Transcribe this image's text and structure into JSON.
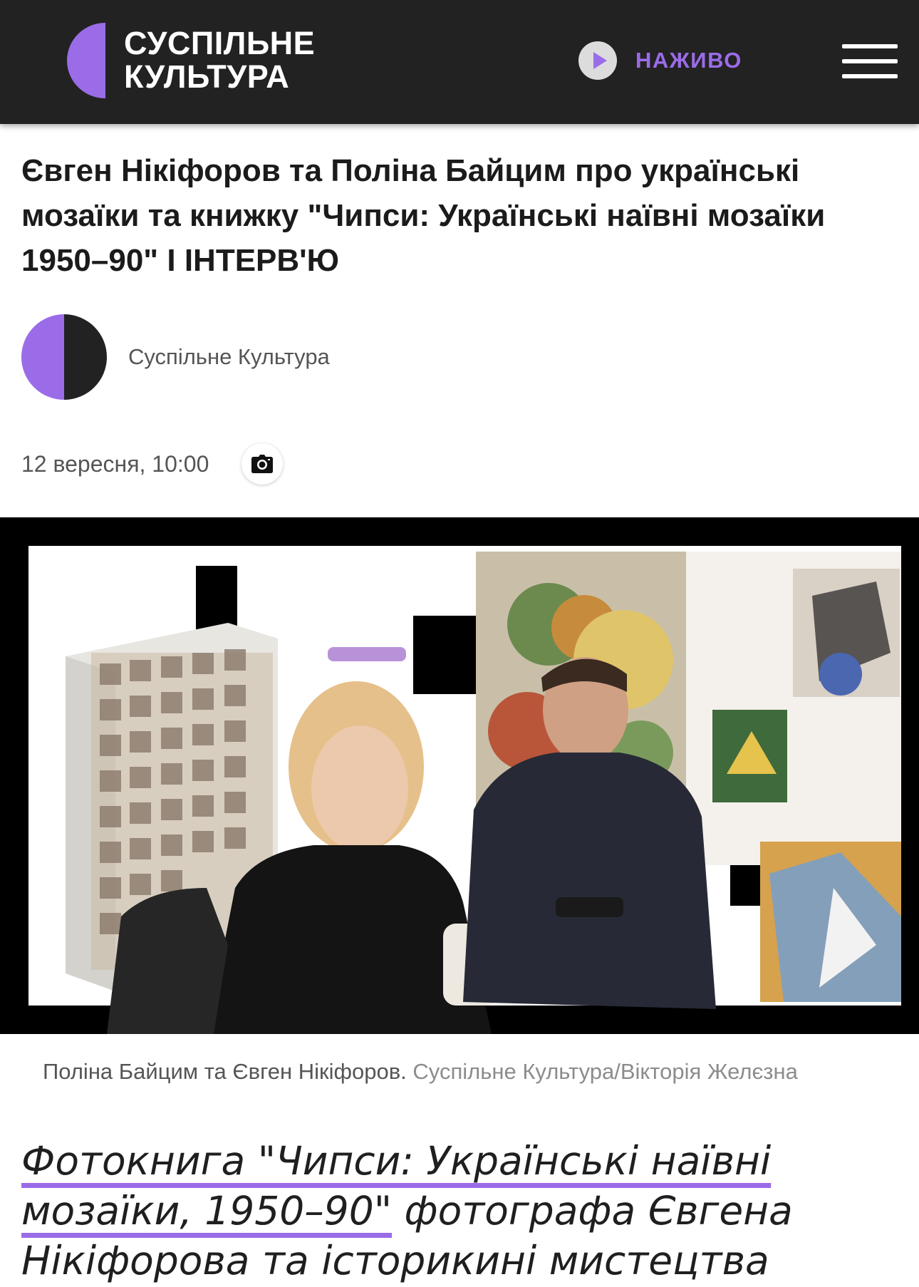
{
  "header": {
    "logo_line1": "СУСПІЛЬНЕ",
    "logo_line2": "КУЛЬТУРА",
    "live_label": "НАЖИВО",
    "live_icon": "play-icon",
    "menu_icon": "hamburger-menu-icon"
  },
  "colors": {
    "accent": "#9b6ce8",
    "header_bg": "#222222"
  },
  "article": {
    "title": "Євген Нікіфоров та Поліна Байцим про українські мозаїки та книжку \"Чипси: Українські наївні мозаїки 1950–90\" І ІНТЕРВ'Ю",
    "author": "Суспільне Культура",
    "date": "12 вересня, 10:00",
    "photo_icon": "camera-icon",
    "caption_text": "Поліна Байцим та Євген Нікіфоров.",
    "caption_credit": "Суспільне Культура/Вікторія Желєзна",
    "lead_link": "Фотокнига \"Чипси: Українські наївні мозаїки, 1950–90\"",
    "lead_rest": " фотографа Євгена Нікіфорова та історикині мистецтва Поліни Байцим"
  }
}
